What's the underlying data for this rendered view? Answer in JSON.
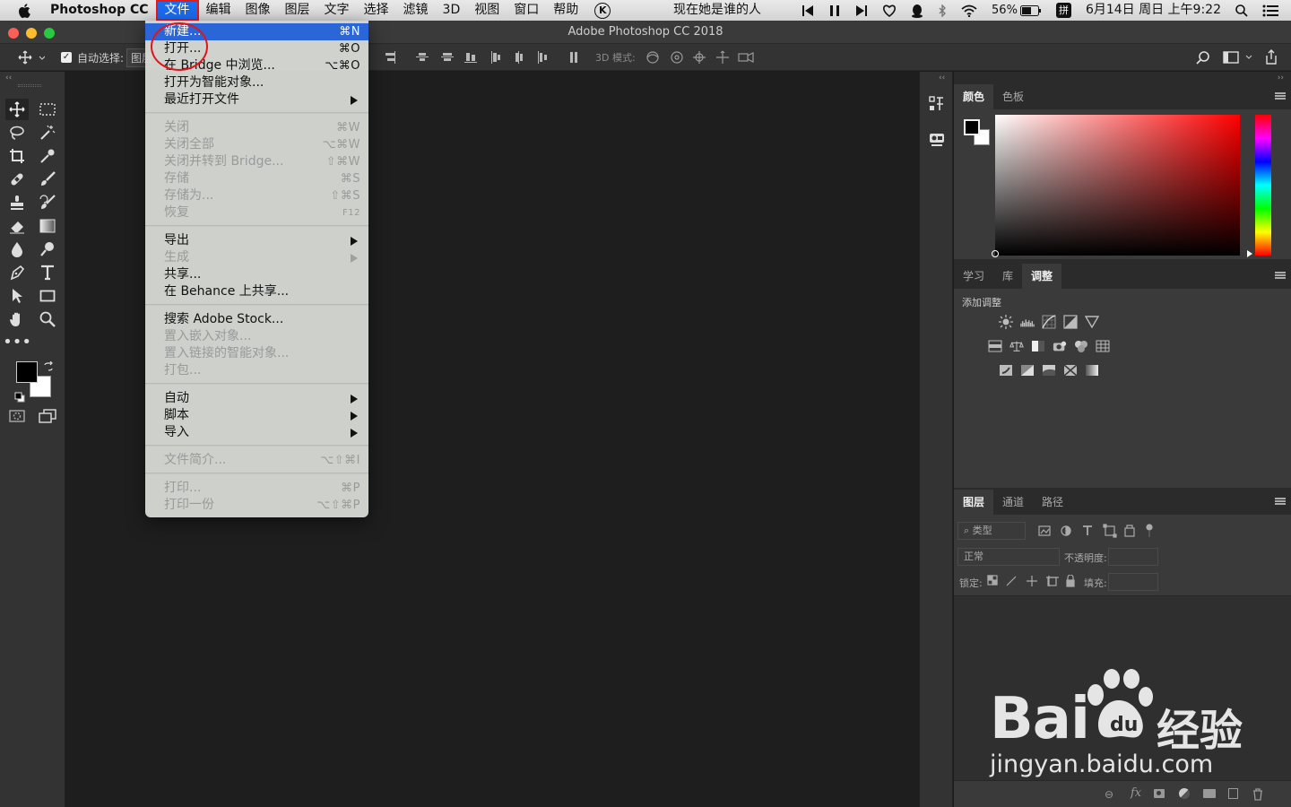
{
  "menubar": {
    "app_name": "Photoshop CC",
    "items": [
      "文件",
      "编辑",
      "图像",
      "图层",
      "文字",
      "选择",
      "滤镜",
      "3D",
      "视图",
      "窗口",
      "帮助"
    ],
    "k_icon": "K",
    "now_playing": "现在她是谁的人",
    "battery": "56%",
    "input_method": "拼",
    "datetime": "6月14日 周日 上午9:22"
  },
  "window": {
    "title": "Adobe Photoshop CC 2018"
  },
  "options_bar": {
    "auto_select_label": "自动选择:",
    "auto_select_value": "图层",
    "mode_3d_label": "3D 模式:"
  },
  "file_menu": {
    "items": [
      {
        "label": "新建...",
        "shortcut": "⌘N"
      },
      {
        "label": "打开...",
        "shortcut": "⌘O"
      },
      {
        "label": "在 Bridge 中浏览...",
        "shortcut": "⌥⌘O"
      },
      {
        "label": "打开为智能对象...",
        "shortcut": ""
      },
      {
        "label": "最近打开文件",
        "shortcut": ""
      },
      {
        "label": "关闭",
        "shortcut": "⌘W"
      },
      {
        "label": "关闭全部",
        "shortcut": "⌥⌘W"
      },
      {
        "label": "关闭并转到 Bridge...",
        "shortcut": "⇧⌘W"
      },
      {
        "label": "存储",
        "shortcut": "⌘S"
      },
      {
        "label": "存储为...",
        "shortcut": "⇧⌘S"
      },
      {
        "label": "恢复",
        "shortcut": "F12"
      },
      {
        "label": "导出",
        "shortcut": ""
      },
      {
        "label": "生成",
        "shortcut": ""
      },
      {
        "label": "共享...",
        "shortcut": ""
      },
      {
        "label": "在 Behance 上共享...",
        "shortcut": ""
      },
      {
        "label": "搜索 Adobe Stock...",
        "shortcut": ""
      },
      {
        "label": "置入嵌入对象...",
        "shortcut": ""
      },
      {
        "label": "置入链接的智能对象...",
        "shortcut": ""
      },
      {
        "label": "打包...",
        "shortcut": ""
      },
      {
        "label": "自动",
        "shortcut": ""
      },
      {
        "label": "脚本",
        "shortcut": ""
      },
      {
        "label": "导入",
        "shortcut": ""
      },
      {
        "label": "文件简介...",
        "shortcut": "⌥⇧⌘I"
      },
      {
        "label": "打印...",
        "shortcut": "⌘P"
      },
      {
        "label": "打印一份",
        "shortcut": "⌥⇧⌘P"
      }
    ]
  },
  "color_panel": {
    "tabs": [
      "颜色",
      "色板"
    ],
    "hue_color": "#ff0000"
  },
  "adjust_panel": {
    "tabs": [
      "学习",
      "库",
      "调整"
    ],
    "heading": "添加调整"
  },
  "layers_panel": {
    "tabs": [
      "图层",
      "通道",
      "路径"
    ],
    "filter_kind": "类型",
    "blend_mode": "正常",
    "opacity_label": "不透明度:",
    "lock_label": "锁定:",
    "fill_label": "填充:",
    "footer_fx": "fx"
  },
  "watermark": {
    "brand": "Bai",
    "brand_suffix": "经验",
    "url": "jingyan.baidu.com"
  }
}
